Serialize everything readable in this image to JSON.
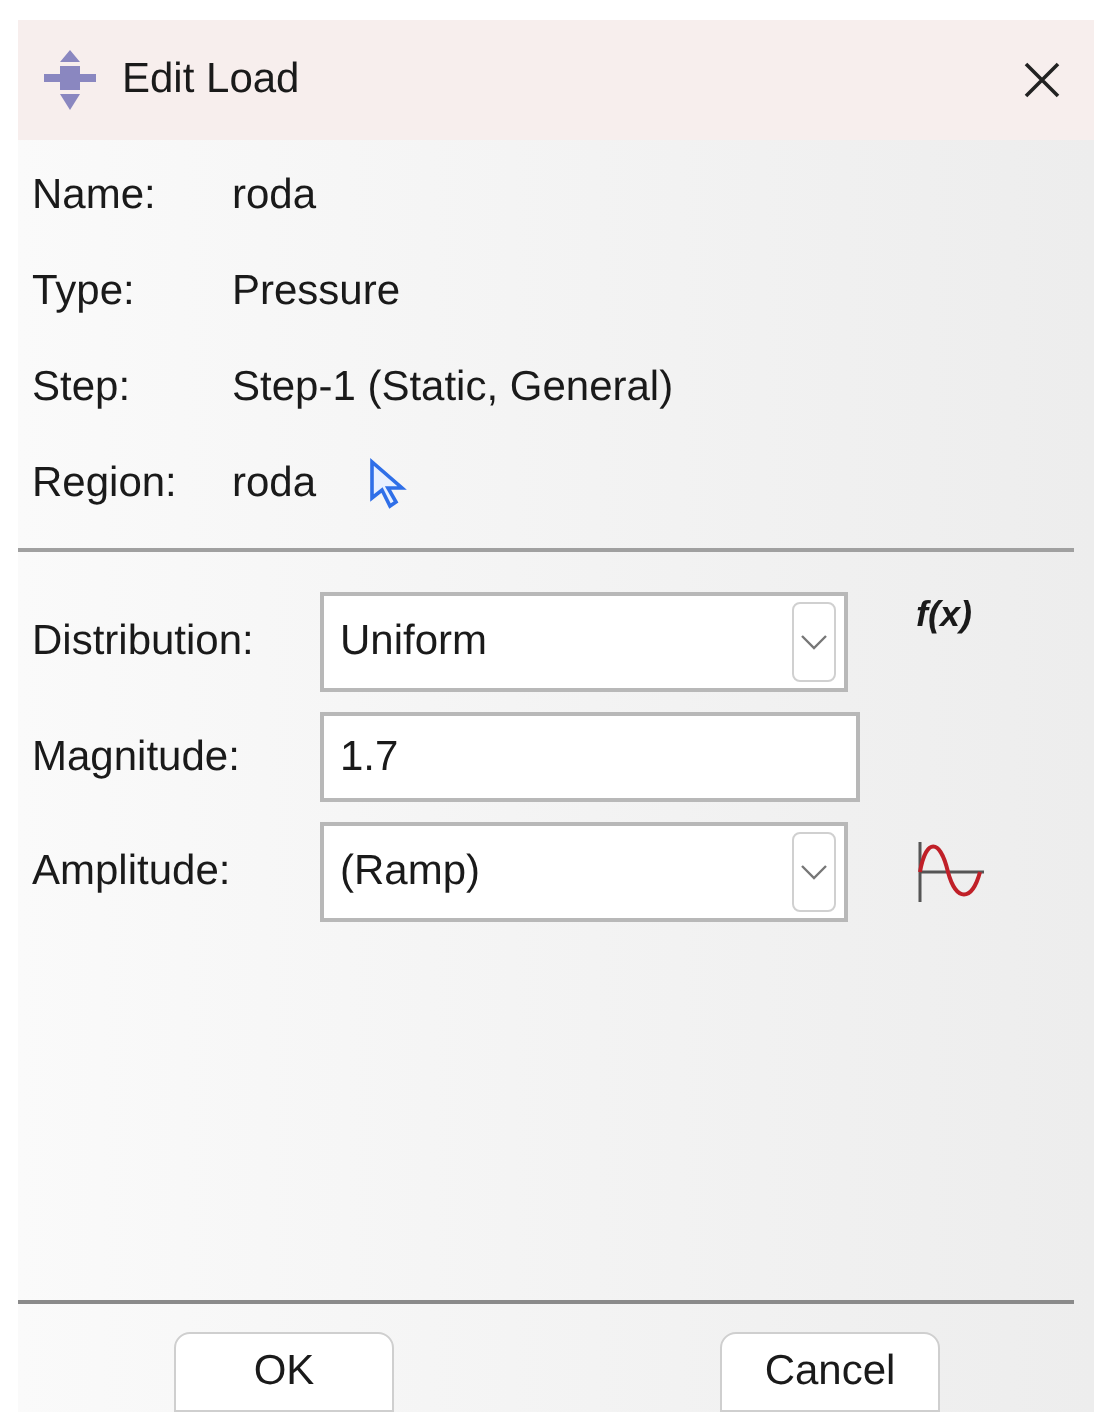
{
  "window": {
    "title": "Edit Load"
  },
  "info": [
    {
      "label": "Name:",
      "value": "roda",
      "kind": "text"
    },
    {
      "label": "Type:",
      "value": "Pressure",
      "kind": "text"
    },
    {
      "label": "Step:",
      "value": "Step-1 (Static, General)",
      "kind": "text"
    },
    {
      "label": "Region:",
      "value": "roda",
      "kind": "pick"
    }
  ],
  "fields": [
    {
      "label": "Distribution:",
      "value": "Uniform",
      "kind": "dropdown",
      "extra": "f(x)"
    },
    {
      "label": "Magnitude:",
      "value": "1.7",
      "kind": "input"
    },
    {
      "label": "Amplitude:",
      "value": "(Ramp)",
      "kind": "dropdown",
      "action": {
        "kind": "waveform"
      }
    }
  ],
  "buttons": [
    "OK",
    "Cancel"
  ]
}
